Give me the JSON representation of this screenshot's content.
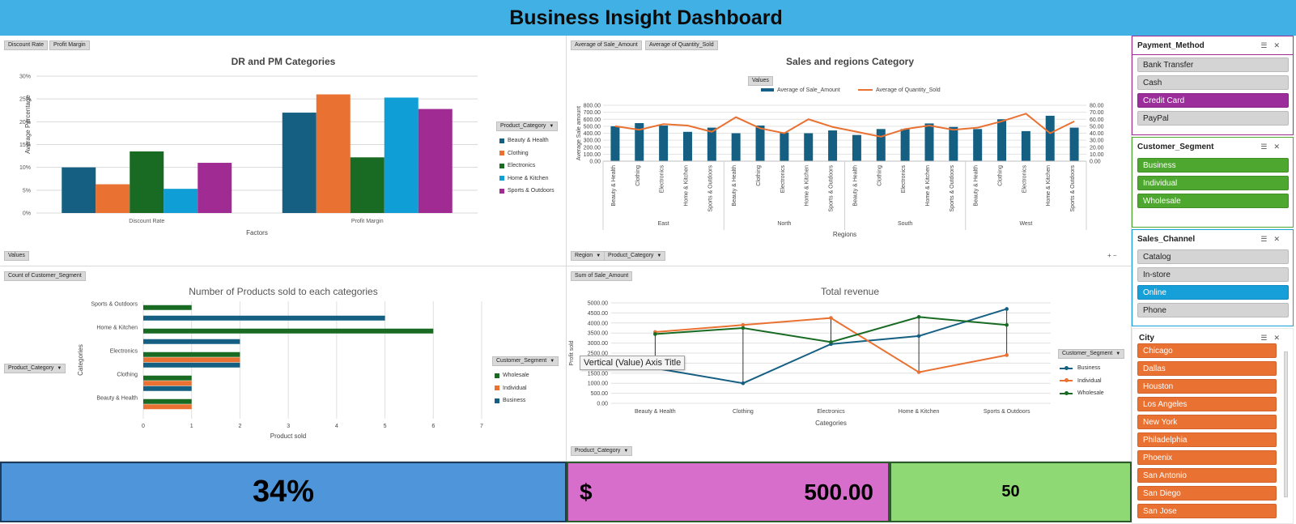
{
  "header": {
    "title": "Business Insight Dashboard"
  },
  "chart1": {
    "pills_top": [
      "Discount Rate",
      "Profit Margin"
    ],
    "pill_bottom": "Values",
    "legend_filter": "Product_Category",
    "chart_data": {
      "type": "bar",
      "title": "DR and PM Categories",
      "xlabel": "Factors",
      "ylabel": "Average Percentage",
      "categories": [
        "Discount Rate",
        "Profit Margin"
      ],
      "yticks": [
        "0%",
        "5%",
        "10%",
        "15%",
        "20%",
        "25%",
        "30%"
      ],
      "ylim": [
        0,
        30
      ],
      "series": [
        {
          "name": "Beauty & Health",
          "color": "#156082",
          "values": [
            10,
            22
          ]
        },
        {
          "name": "Clothing",
          "color": "#e97132",
          "values": [
            6.3,
            26
          ]
        },
        {
          "name": "Electronics",
          "color": "#196b24",
          "values": [
            13.5,
            12.2
          ]
        },
        {
          "name": "Home & Kitchen",
          "color": "#0f9ed5",
          "values": [
            5.3,
            25.3
          ]
        },
        {
          "name": "Sports & Outdoors",
          "color": "#a02b93",
          "values": [
            11,
            22.8
          ]
        }
      ]
    }
  },
  "chart2": {
    "pills_top": [
      "Average of Sale_Amount",
      "Average of Quantity_Sold"
    ],
    "values_pill": "Values",
    "pills_bottom": [
      "Region",
      "Product_Category"
    ],
    "chart_data": {
      "type": "bar-line",
      "title": "Sales and regions Category",
      "xlabel": "Regions",
      "ylabel": "Average Sale amount",
      "ylim": [
        0,
        800
      ],
      "y2lim": [
        0,
        80
      ],
      "yticks": [
        "0.00",
        "100.00",
        "200.00",
        "300.00",
        "400.00",
        "500.00",
        "600.00",
        "700.00",
        "800.00"
      ],
      "y2ticks": [
        "0.00",
        "10.00",
        "20.00",
        "30.00",
        "40.00",
        "50.00",
        "60.00",
        "70.00",
        "80.00"
      ],
      "groups": [
        "East",
        "North",
        "South",
        "West"
      ],
      "categories": [
        "Beauty & Health",
        "Clothing",
        "Electronics",
        "Home & Kitchen",
        "Sports & Outdoors"
      ],
      "series": [
        {
          "name": "Average of Sale_Amount",
          "color": "#156082",
          "values": [
            500,
            545,
            510,
            420,
            480,
            400,
            510,
            410,
            400,
            440,
            375,
            460,
            460,
            540,
            490,
            460,
            600,
            430,
            650,
            480
          ]
        },
        {
          "name": "Average of Quantity_Sold",
          "color": "#e97132",
          "values": [
            50,
            45,
            53,
            51,
            42,
            63,
            47,
            40,
            60,
            49,
            42,
            35,
            46,
            51,
            45,
            48,
            57,
            68,
            40,
            57
          ]
        }
      ]
    }
  },
  "chart3": {
    "pill_top": "Count of Customer_Segment",
    "axis_filter": "Product_Category",
    "legend_filter": "Customer_Segment",
    "chart_data": {
      "type": "bar",
      "orientation": "horizontal",
      "title": "Number of Products sold to each categories",
      "xlabel": "Product sold",
      "ylabel": "Categories",
      "xlim": [
        0,
        7
      ],
      "xticks": [
        "0",
        "1",
        "2",
        "3",
        "4",
        "5",
        "6",
        "7"
      ],
      "categories": [
        "Beauty & Health",
        "Clothing",
        "Electronics",
        "Home & Kitchen",
        "Sports & Outdoors"
      ],
      "series": [
        {
          "name": "Wholesale",
          "color": "#196b24",
          "values": [
            1,
            1,
            2,
            6,
            1
          ]
        },
        {
          "name": "Individual",
          "color": "#e97132",
          "values": [
            1,
            1,
            2,
            0,
            0
          ]
        },
        {
          "name": "Business",
          "color": "#156082",
          "values": [
            0,
            1,
            2,
            2,
            5
          ]
        }
      ]
    }
  },
  "chart4": {
    "pill_top": "Sum of Sale_Amount",
    "pill_bottom": "Product_Category",
    "legend_filter": "Customer_Segment",
    "tooltip": "Vertical (Value) Axis Title",
    "chart_data": {
      "type": "line",
      "title": "Total revenue",
      "xlabel": "Categories",
      "ylabel": "Profit sold",
      "ylim": [
        0,
        5000
      ],
      "yticks": [
        "0.00",
        "500.00",
        "1000.00",
        "1500.00",
        "2000.00",
        "2500.00",
        "3000.00",
        "3500.00",
        "4000.00",
        "4500.00",
        "5000.00"
      ],
      "categories": [
        "Beauty & Health",
        "Clothing",
        "Electronics",
        "Home & Kitchen",
        "Sports & Outdoors"
      ],
      "series": [
        {
          "name": "Business",
          "color": "#156082",
          "values": [
            1750,
            1000,
            2950,
            3350,
            4700
          ]
        },
        {
          "name": "Individual",
          "color": "#e97132",
          "values": [
            3550,
            3900,
            4250,
            1550,
            2400
          ]
        },
        {
          "name": "Wholesale",
          "color": "#196b24",
          "values": [
            3450,
            3750,
            3050,
            4300,
            3900
          ]
        }
      ]
    }
  },
  "kpis": {
    "discount": "34%",
    "currency": "$",
    "sale_amount": "500.00",
    "quantity": "50"
  },
  "slicers": {
    "payment": {
      "title": "Payment_Method",
      "items": [
        "Bank Transfer",
        "Cash",
        "Credit Card",
        "PayPal"
      ],
      "selected": "Credit Card"
    },
    "segment": {
      "title": "Customer_Segment",
      "items": [
        "Business",
        "Individual",
        "Wholesale"
      ]
    },
    "channel": {
      "title": "Sales_Channel",
      "items": [
        "Catalog",
        "In-store",
        "Online",
        "Phone"
      ],
      "selected": "Online"
    },
    "city": {
      "title": "City",
      "items": [
        "Chicago",
        "Dallas",
        "Houston",
        "Los Angeles",
        "New York",
        "Philadelphia",
        "Phoenix",
        "San Antonio",
        "San Diego",
        "San Jose"
      ]
    }
  }
}
